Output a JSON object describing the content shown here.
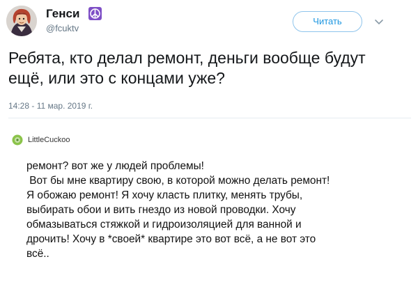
{
  "author": {
    "display_name": "Генси",
    "handle": "@fcuktv",
    "badge_icon": "peace-icon",
    "avatar_icon": "avatar"
  },
  "follow_label": "Читать",
  "menu_icon": "chevron-down-icon",
  "tweet_text": "Ребята, кто делал ремонт, деньги вообще будут ещё, или это с концами уже?",
  "timestamp": "14:28 - 11 мар. 2019 г.",
  "embedded_post": {
    "author": "LittleCuckoo",
    "lines": [
      "ремонт? вот же у людей проблемы!",
      " Вот бы мне квартиру свою, в которой можно делать ремонт!",
      "Я обожаю ремонт! Я хочу класть плитку, менять трубы,",
      "выбирать обои и вить гнездо из новой проводки. Хочу",
      "обмазываться стяжкой и гидроизоляцией для ванной и",
      "дрочить! Хочу в *своей* квартире это вот всё, а не вот это",
      "всё.."
    ]
  },
  "colors": {
    "accent": "#1b95e0",
    "follow_border": "#8ec4ec",
    "secondary_text": "#657786",
    "badge": "#7e4fc6"
  }
}
